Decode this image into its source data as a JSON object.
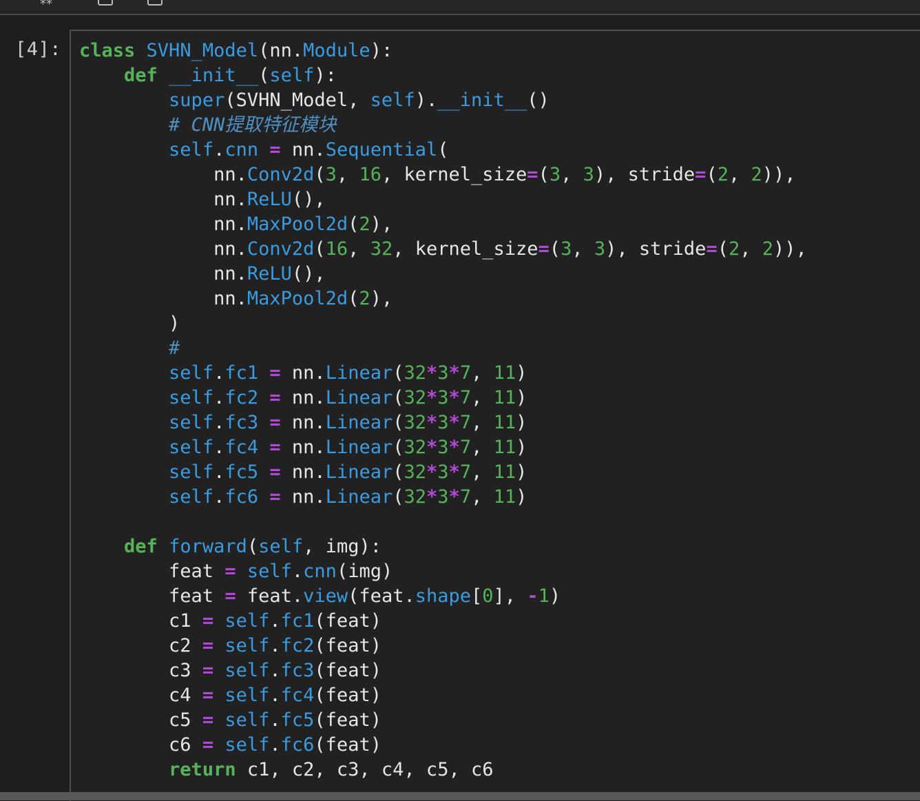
{
  "cell": {
    "prompt": "[4]:",
    "lines": [
      [
        [
          "kw",
          "class"
        ],
        [
          "pl",
          " "
        ],
        [
          "fn",
          "SVHN_Model"
        ],
        [
          "pl",
          "(nn."
        ],
        [
          "fn",
          "Module"
        ],
        [
          "pl",
          "):"
        ]
      ],
      [
        [
          "pl",
          "    "
        ],
        [
          "kw",
          "def"
        ],
        [
          "pl",
          " "
        ],
        [
          "fn",
          "__init__"
        ],
        [
          "pl",
          "("
        ],
        [
          "bl",
          "self"
        ],
        [
          "pl",
          "):"
        ]
      ],
      [
        [
          "pl",
          "        "
        ],
        [
          "bl",
          "super"
        ],
        [
          "pl",
          "(SVHN_Model, "
        ],
        [
          "bl",
          "self"
        ],
        [
          "pl",
          ")."
        ],
        [
          "fn",
          "__init__"
        ],
        [
          "pl",
          "()"
        ]
      ],
      [
        [
          "pl",
          "        "
        ],
        [
          "cm",
          "# CNN提取特征模块"
        ]
      ],
      [
        [
          "pl",
          "        "
        ],
        [
          "bl",
          "self"
        ],
        [
          "pl",
          "."
        ],
        [
          "fn",
          "cnn"
        ],
        [
          "pl",
          " "
        ],
        [
          "op",
          "="
        ],
        [
          "pl",
          " nn."
        ],
        [
          "fn",
          "Sequential"
        ],
        [
          "pl",
          "("
        ]
      ],
      [
        [
          "pl",
          "            nn."
        ],
        [
          "fn",
          "Conv2d"
        ],
        [
          "pl",
          "("
        ],
        [
          "num",
          "3"
        ],
        [
          "pl",
          ", "
        ],
        [
          "num",
          "16"
        ],
        [
          "pl",
          ", kernel_size"
        ],
        [
          "op",
          "="
        ],
        [
          "pl",
          "("
        ],
        [
          "num",
          "3"
        ],
        [
          "pl",
          ", "
        ],
        [
          "num",
          "3"
        ],
        [
          "pl",
          "), stride"
        ],
        [
          "op",
          "="
        ],
        [
          "pl",
          "("
        ],
        [
          "num",
          "2"
        ],
        [
          "pl",
          ", "
        ],
        [
          "num",
          "2"
        ],
        [
          "pl",
          ")),"
        ]
      ],
      [
        [
          "pl",
          "            nn."
        ],
        [
          "fn",
          "ReLU"
        ],
        [
          "pl",
          "(),"
        ]
      ],
      [
        [
          "pl",
          "            nn."
        ],
        [
          "fn",
          "MaxPool2d"
        ],
        [
          "pl",
          "("
        ],
        [
          "num",
          "2"
        ],
        [
          "pl",
          "),"
        ]
      ],
      [
        [
          "pl",
          "            nn."
        ],
        [
          "fn",
          "Conv2d"
        ],
        [
          "pl",
          "("
        ],
        [
          "num",
          "16"
        ],
        [
          "pl",
          ", "
        ],
        [
          "num",
          "32"
        ],
        [
          "pl",
          ", kernel_size"
        ],
        [
          "op",
          "="
        ],
        [
          "pl",
          "("
        ],
        [
          "num",
          "3"
        ],
        [
          "pl",
          ", "
        ],
        [
          "num",
          "3"
        ],
        [
          "pl",
          "), stride"
        ],
        [
          "op",
          "="
        ],
        [
          "pl",
          "("
        ],
        [
          "num",
          "2"
        ],
        [
          "pl",
          ", "
        ],
        [
          "num",
          "2"
        ],
        [
          "pl",
          ")),"
        ]
      ],
      [
        [
          "pl",
          "            nn."
        ],
        [
          "fn",
          "ReLU"
        ],
        [
          "pl",
          "(),"
        ]
      ],
      [
        [
          "pl",
          "            nn."
        ],
        [
          "fn",
          "MaxPool2d"
        ],
        [
          "pl",
          "("
        ],
        [
          "num",
          "2"
        ],
        [
          "pl",
          "),"
        ]
      ],
      [
        [
          "pl",
          "        )"
        ]
      ],
      [
        [
          "pl",
          "        "
        ],
        [
          "cm",
          "#"
        ]
      ],
      [
        [
          "pl",
          "        "
        ],
        [
          "bl",
          "self"
        ],
        [
          "pl",
          "."
        ],
        [
          "fn",
          "fc1"
        ],
        [
          "pl",
          " "
        ],
        [
          "op",
          "="
        ],
        [
          "pl",
          " nn."
        ],
        [
          "fn",
          "Linear"
        ],
        [
          "pl",
          "("
        ],
        [
          "num",
          "32"
        ],
        [
          "op",
          "*"
        ],
        [
          "num",
          "3"
        ],
        [
          "op",
          "*"
        ],
        [
          "num",
          "7"
        ],
        [
          "pl",
          ", "
        ],
        [
          "num",
          "11"
        ],
        [
          "pl",
          ")"
        ]
      ],
      [
        [
          "pl",
          "        "
        ],
        [
          "bl",
          "self"
        ],
        [
          "pl",
          "."
        ],
        [
          "fn",
          "fc2"
        ],
        [
          "pl",
          " "
        ],
        [
          "op",
          "="
        ],
        [
          "pl",
          " nn."
        ],
        [
          "fn",
          "Linear"
        ],
        [
          "pl",
          "("
        ],
        [
          "num",
          "32"
        ],
        [
          "op",
          "*"
        ],
        [
          "num",
          "3"
        ],
        [
          "op",
          "*"
        ],
        [
          "num",
          "7"
        ],
        [
          "pl",
          ", "
        ],
        [
          "num",
          "11"
        ],
        [
          "pl",
          ")"
        ]
      ],
      [
        [
          "pl",
          "        "
        ],
        [
          "bl",
          "self"
        ],
        [
          "pl",
          "."
        ],
        [
          "fn",
          "fc3"
        ],
        [
          "pl",
          " "
        ],
        [
          "op",
          "="
        ],
        [
          "pl",
          " nn."
        ],
        [
          "fn",
          "Linear"
        ],
        [
          "pl",
          "("
        ],
        [
          "num",
          "32"
        ],
        [
          "op",
          "*"
        ],
        [
          "num",
          "3"
        ],
        [
          "op",
          "*"
        ],
        [
          "num",
          "7"
        ],
        [
          "pl",
          ", "
        ],
        [
          "num",
          "11"
        ],
        [
          "pl",
          ")"
        ]
      ],
      [
        [
          "pl",
          "        "
        ],
        [
          "bl",
          "self"
        ],
        [
          "pl",
          "."
        ],
        [
          "fn",
          "fc4"
        ],
        [
          "pl",
          " "
        ],
        [
          "op",
          "="
        ],
        [
          "pl",
          " nn."
        ],
        [
          "fn",
          "Linear"
        ],
        [
          "pl",
          "("
        ],
        [
          "num",
          "32"
        ],
        [
          "op",
          "*"
        ],
        [
          "num",
          "3"
        ],
        [
          "op",
          "*"
        ],
        [
          "num",
          "7"
        ],
        [
          "pl",
          ", "
        ],
        [
          "num",
          "11"
        ],
        [
          "pl",
          ")"
        ]
      ],
      [
        [
          "pl",
          "        "
        ],
        [
          "bl",
          "self"
        ],
        [
          "pl",
          "."
        ],
        [
          "fn",
          "fc5"
        ],
        [
          "pl",
          " "
        ],
        [
          "op",
          "="
        ],
        [
          "pl",
          " nn."
        ],
        [
          "fn",
          "Linear"
        ],
        [
          "pl",
          "("
        ],
        [
          "num",
          "32"
        ],
        [
          "op",
          "*"
        ],
        [
          "num",
          "3"
        ],
        [
          "op",
          "*"
        ],
        [
          "num",
          "7"
        ],
        [
          "pl",
          ", "
        ],
        [
          "num",
          "11"
        ],
        [
          "pl",
          ")"
        ]
      ],
      [
        [
          "pl",
          "        "
        ],
        [
          "bl",
          "self"
        ],
        [
          "pl",
          "."
        ],
        [
          "fn",
          "fc6"
        ],
        [
          "pl",
          " "
        ],
        [
          "op",
          "="
        ],
        [
          "pl",
          " nn."
        ],
        [
          "fn",
          "Linear"
        ],
        [
          "pl",
          "("
        ],
        [
          "num",
          "32"
        ],
        [
          "op",
          "*"
        ],
        [
          "num",
          "3"
        ],
        [
          "op",
          "*"
        ],
        [
          "num",
          "7"
        ],
        [
          "pl",
          ", "
        ],
        [
          "num",
          "11"
        ],
        [
          "pl",
          ")"
        ]
      ],
      [
        [
          "pl",
          ""
        ]
      ],
      [
        [
          "pl",
          "    "
        ],
        [
          "kw",
          "def"
        ],
        [
          "pl",
          " "
        ],
        [
          "fn",
          "forward"
        ],
        [
          "pl",
          "("
        ],
        [
          "bl",
          "self"
        ],
        [
          "pl",
          ", img):"
        ]
      ],
      [
        [
          "pl",
          "        feat "
        ],
        [
          "op",
          "="
        ],
        [
          "pl",
          " "
        ],
        [
          "bl",
          "self"
        ],
        [
          "pl",
          "."
        ],
        [
          "fn",
          "cnn"
        ],
        [
          "pl",
          "(img)"
        ]
      ],
      [
        [
          "pl",
          "        feat "
        ],
        [
          "op",
          "="
        ],
        [
          "pl",
          " feat."
        ],
        [
          "fn",
          "view"
        ],
        [
          "pl",
          "(feat."
        ],
        [
          "fn",
          "shape"
        ],
        [
          "pl",
          "["
        ],
        [
          "num",
          "0"
        ],
        [
          "pl",
          "], "
        ],
        [
          "op",
          "-"
        ],
        [
          "num",
          "1"
        ],
        [
          "pl",
          ")"
        ]
      ],
      [
        [
          "pl",
          "        c1 "
        ],
        [
          "op",
          "="
        ],
        [
          "pl",
          " "
        ],
        [
          "bl",
          "self"
        ],
        [
          "pl",
          "."
        ],
        [
          "fn",
          "fc1"
        ],
        [
          "pl",
          "(feat)"
        ]
      ],
      [
        [
          "pl",
          "        c2 "
        ],
        [
          "op",
          "="
        ],
        [
          "pl",
          " "
        ],
        [
          "bl",
          "self"
        ],
        [
          "pl",
          "."
        ],
        [
          "fn",
          "fc2"
        ],
        [
          "pl",
          "(feat)"
        ]
      ],
      [
        [
          "pl",
          "        c3 "
        ],
        [
          "op",
          "="
        ],
        [
          "pl",
          " "
        ],
        [
          "bl",
          "self"
        ],
        [
          "pl",
          "."
        ],
        [
          "fn",
          "fc3"
        ],
        [
          "pl",
          "(feat)"
        ]
      ],
      [
        [
          "pl",
          "        c4 "
        ],
        [
          "op",
          "="
        ],
        [
          "pl",
          " "
        ],
        [
          "bl",
          "self"
        ],
        [
          "pl",
          "."
        ],
        [
          "fn",
          "fc4"
        ],
        [
          "pl",
          "(feat)"
        ]
      ],
      [
        [
          "pl",
          "        c5 "
        ],
        [
          "op",
          "="
        ],
        [
          "pl",
          " "
        ],
        [
          "bl",
          "self"
        ],
        [
          "pl",
          "."
        ],
        [
          "fn",
          "fc5"
        ],
        [
          "pl",
          "(feat)"
        ]
      ],
      [
        [
          "pl",
          "        c6 "
        ],
        [
          "op",
          "="
        ],
        [
          "pl",
          " "
        ],
        [
          "bl",
          "self"
        ],
        [
          "pl",
          "."
        ],
        [
          "fn",
          "fc6"
        ],
        [
          "pl",
          "(feat)"
        ]
      ],
      [
        [
          "pl",
          "        "
        ],
        [
          "kw",
          "return"
        ],
        [
          "pl",
          " c1, c2, c3, c4, c5, c6"
        ]
      ]
    ]
  },
  "colors": {
    "keyword": "#57b35a",
    "builtin": "#3b9be0",
    "number": "#57b35a",
    "operator": "#b04ad6",
    "comment": "#4f90c4",
    "text": "#e6e6e6",
    "background": "#212121"
  },
  "toolbar": {
    "icons": [
      "run-icon",
      "copy-icon",
      "paste-icon"
    ]
  }
}
